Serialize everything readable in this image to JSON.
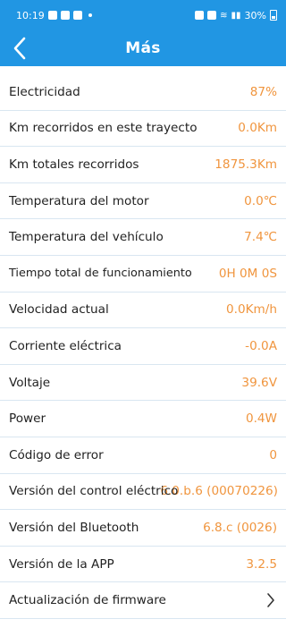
{
  "status_bar": {
    "time": "10:19",
    "battery": "30%"
  },
  "header": {
    "title": "Más"
  },
  "rows": [
    {
      "label": "Electricidad",
      "value": "87%"
    },
    {
      "label": "Km recorridos en este trayecto",
      "value": "0.0Km"
    },
    {
      "label": "Km totales recorridos",
      "value": "1875.3Km"
    },
    {
      "label": "Temperatura del motor",
      "value": "0.0℃"
    },
    {
      "label": "Temperatura del vehículo",
      "value": "7.4℃"
    },
    {
      "label": "Tiempo total de funcionamiento",
      "value": "0H 0M 0S"
    },
    {
      "label": "Velocidad actual",
      "value": "0.0Km/h"
    },
    {
      "label": "Corriente eléctrica",
      "value": "-0.0A"
    },
    {
      "label": "Voltaje",
      "value": "39.6V"
    },
    {
      "label": "Power",
      "value": "0.4W"
    },
    {
      "label": "Código de error",
      "value": "0"
    },
    {
      "label": "Versión del control eléctrico",
      "value": "6.0.b.6 (00070226)"
    },
    {
      "label": "Versión del Bluetooth",
      "value": "6.8.c (0026)"
    },
    {
      "label": "Versión de la APP",
      "value": "3.2.5"
    },
    {
      "label": "Actualización de firmware",
      "value": ""
    }
  ],
  "colors": {
    "primary": "#2196e3",
    "value": "#f0953e",
    "divider": "#d9e6f1"
  },
  "icons": {
    "back": "chevron-left-icon",
    "row_arrow": "chevron-right-icon"
  }
}
